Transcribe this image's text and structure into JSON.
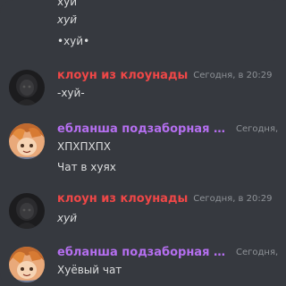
{
  "top_lines": [
    {
      "text": "хуй",
      "italic": false
    },
    {
      "text": "хуй",
      "italic": true
    },
    {
      "text": "•хуй•",
      "italic": false
    }
  ],
  "messages": [
    {
      "username": "клоун из клоунады",
      "timestamp": "Сегодня, в 20:29",
      "lines": [
        "-хуй-"
      ],
      "italic_lines": [
        false
      ]
    },
    {
      "username": "ебланша подзаборная р...",
      "timestamp": "Сегодня,",
      "lines": [
        "ХПХПХПХ",
        "Чат в хуях"
      ],
      "italic_lines": [
        false,
        false
      ]
    },
    {
      "username": "клоун из клоунады",
      "timestamp": "Сегодня, в 20:29",
      "lines": [
        "хуй"
      ],
      "italic_lines": [
        true
      ]
    },
    {
      "username": "ебланша подзаборная р...",
      "timestamp": "Сегодня,",
      "lines": [
        "Хуёвый чат"
      ],
      "italic_lines": [
        false
      ]
    }
  ],
  "colors": {
    "background": "#36393f",
    "clown_name": "#f04747",
    "purple_name": "#b56ff0",
    "timestamp": "#8e9297",
    "text": "#dcddde"
  }
}
